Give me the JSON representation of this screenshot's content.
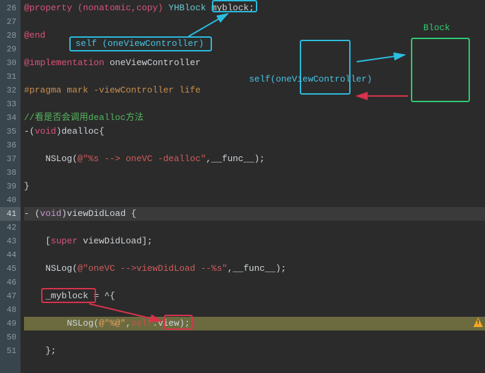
{
  "gutter": {
    "start": 26,
    "end": 51,
    "current": 41
  },
  "code": {
    "l26": {
      "property": "@property",
      "attrs": "(nonatomic,copy)",
      "type": "YHBlock",
      "name": " myblock;"
    },
    "l27": "",
    "l28": {
      "end": "@end"
    },
    "l29": "",
    "l30": {
      "impl": "@implementation ",
      "class": "oneViewController"
    },
    "l31": "",
    "l32": {
      "pragma": "#pragma mark -viewController life"
    },
    "l33": "",
    "l34": {
      "comment": "//看是否会调用dealloc方法"
    },
    "l35": {
      "a": "-(",
      "b": "void",
      "c": ")dealloc{"
    },
    "l36": "",
    "l37": {
      "a": "    NSLog(",
      "b": "@\"%s --> oneVC -dealloc\"",
      "c": ",__func__);"
    },
    "l38": "    ",
    "l39": "}",
    "l40": "",
    "l41": {
      "a": "- (",
      "b": "void",
      "c": ")viewDidLoad {"
    },
    "l42": "",
    "l43": {
      "a": "    [",
      "b": "super",
      "c": " viewDidLoad];"
    },
    "l44": "",
    "l45": {
      "a": "    NSLog(",
      "b": "@\"oneVC -->viewDidLoad --%s\"",
      "c": ",__func__);"
    },
    "l46": "",
    "l47": {
      "a": "    ",
      "b": "_myblock",
      "c": " = ^{"
    },
    "l48": "        ",
    "l49": {
      "a": "        NSLog(",
      "b": "@\"%@\"",
      "c": ",",
      "d": "self",
      "e": ".view);"
    },
    "l50": "        ",
    "l51": "    };"
  },
  "annotations": {
    "selfOne1": "self (oneViewController)",
    "selfOne2": "self(oneViewController)",
    "block": "Block"
  }
}
